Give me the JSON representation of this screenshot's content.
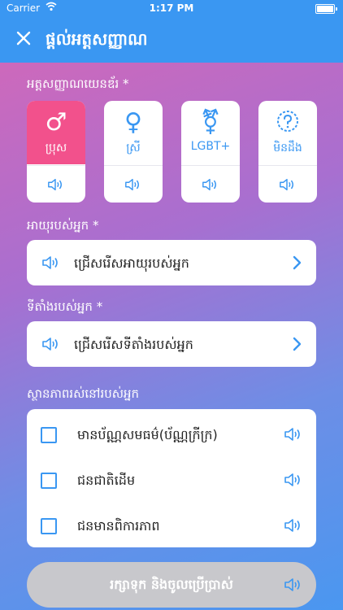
{
  "status_bar": {
    "carrier": "Carrier",
    "time": "1:17 PM"
  },
  "header": {
    "title": "ផ្តល់អត្តសញ្ញាណ",
    "close_icon": "close-icon"
  },
  "gender": {
    "label": "អត្តសញ្ញាណយេនឌ័រ *",
    "options": [
      {
        "symbol": "♂",
        "name": "ប្រុស",
        "selected": true
      },
      {
        "symbol": "♀",
        "name": "ស្រី",
        "selected": false
      },
      {
        "symbol": "⚧",
        "name": "LGBT+",
        "selected": false
      },
      {
        "symbol": "?",
        "name": "មិនដឹង",
        "selected": false
      }
    ]
  },
  "age": {
    "label": "អាយុរបស់អ្នក *",
    "placeholder": "ជ្រើសរើសអាយុរបស់អ្នក"
  },
  "location": {
    "label": "ទីតាំងរបស់អ្នក *",
    "placeholder": "ជ្រើសរើសទីតាំងរបស់អ្នក"
  },
  "status": {
    "label": "ស្ថានភាពរស់នៅរបស់អ្នក",
    "items": [
      {
        "text": "មានប័ណ្ណសមធម៌(ប័ណ្ណក្រីក្រ)",
        "checked": false
      },
      {
        "text": "ជនជាតិដើម",
        "checked": false
      },
      {
        "text": "ជនមានពិការភាព",
        "checked": false
      }
    ]
  },
  "submit": {
    "label": "រក្សាទុក និងចូលប្រើប្រាស់"
  },
  "colors": {
    "accent": "#3a97f2",
    "selected": "#f2518c",
    "disabled": "#c8c8cc"
  }
}
